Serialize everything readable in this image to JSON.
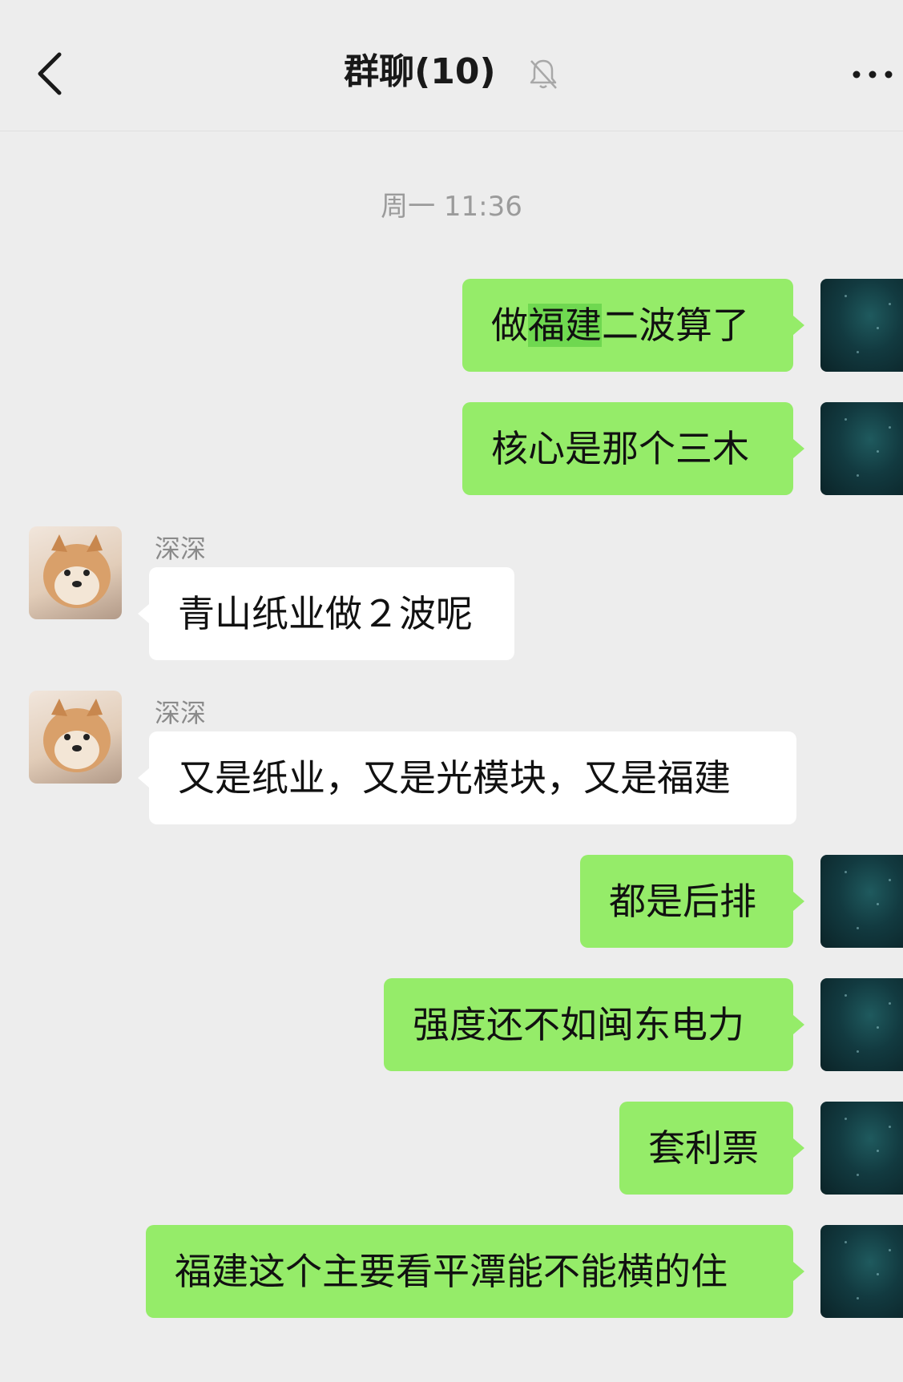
{
  "header": {
    "title": "群聊(10)"
  },
  "chat": {
    "timestamp": "周一 11:36",
    "messages": [
      {
        "side": "out",
        "text_before": "做",
        "highlight": "福建",
        "text_after": "二波算了"
      },
      {
        "side": "out",
        "text": "核心是那个三木"
      },
      {
        "side": "in",
        "sender": "深深",
        "text": "青山纸业做２波呢"
      },
      {
        "side": "in",
        "sender": "深深",
        "text": "又是纸业，又是光模块，又是福建"
      },
      {
        "side": "out",
        "text": "都是后排"
      },
      {
        "side": "out",
        "text": "强度还不如闽东电力"
      },
      {
        "side": "out",
        "text": "套利票"
      },
      {
        "side": "out",
        "text": "福建这个主要看平潭能不能横的住"
      }
    ]
  },
  "colors": {
    "background": "#ededed",
    "outgoing_bubble": "#95ec69",
    "incoming_bubble": "#ffffff",
    "highlight": "#6fd850"
  },
  "icons": [
    "chevron-left-icon",
    "bell-muted-icon",
    "more-dots-icon"
  ]
}
